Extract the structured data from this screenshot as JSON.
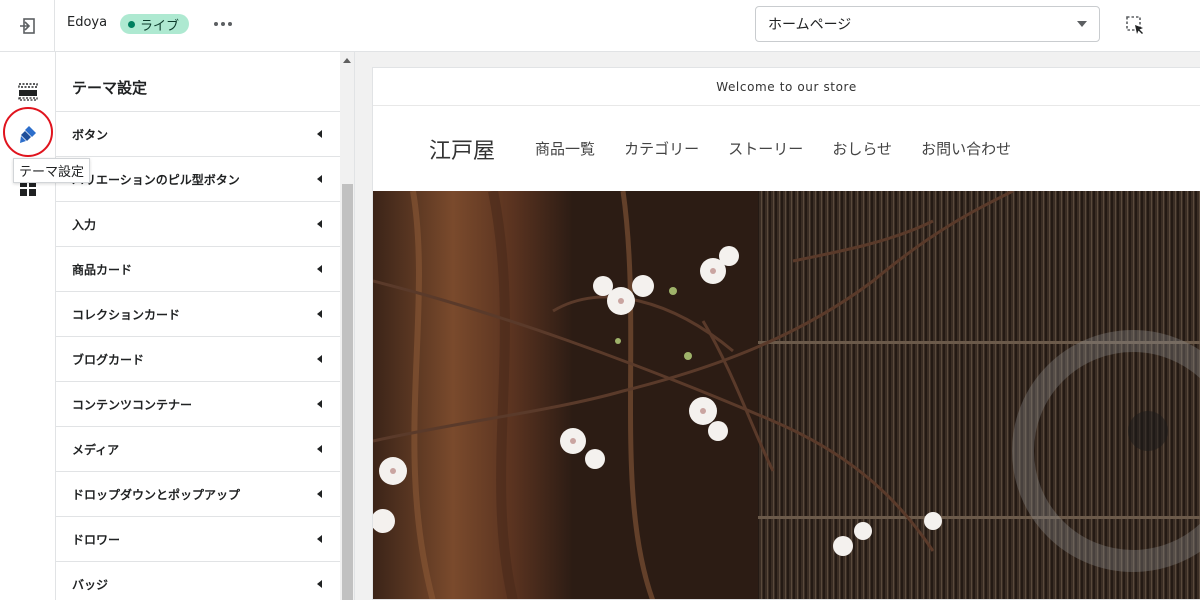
{
  "topbar": {
    "store_name": "Edoya",
    "status_badge": "ライブ",
    "page_select": "ホームページ"
  },
  "rail": {
    "tooltip": "テーマ設定"
  },
  "panel": {
    "title": "テーマ設定",
    "items": [
      {
        "label": "ボタン"
      },
      {
        "label": "バリエーションのピル型ボタン"
      },
      {
        "label": "入力"
      },
      {
        "label": "商品カード"
      },
      {
        "label": "コレクションカード"
      },
      {
        "label": "ブログカード"
      },
      {
        "label": "コンテンツコンテナー"
      },
      {
        "label": "メディア"
      },
      {
        "label": "ドロップダウンとポップアップ"
      },
      {
        "label": "ドロワー"
      },
      {
        "label": "バッジ"
      }
    ]
  },
  "preview": {
    "announcement": "Welcome to our store",
    "logo": "江戸屋",
    "nav": [
      "商品一覧",
      "カテゴリー",
      "ストーリー",
      "おしらせ",
      "お問い合わせ"
    ]
  },
  "colors": {
    "live_badge_bg": "#aee9d1",
    "live_dot": "#007f5f",
    "highlight_ring": "#e0141e",
    "theme_icon": "#2c6ecb"
  }
}
